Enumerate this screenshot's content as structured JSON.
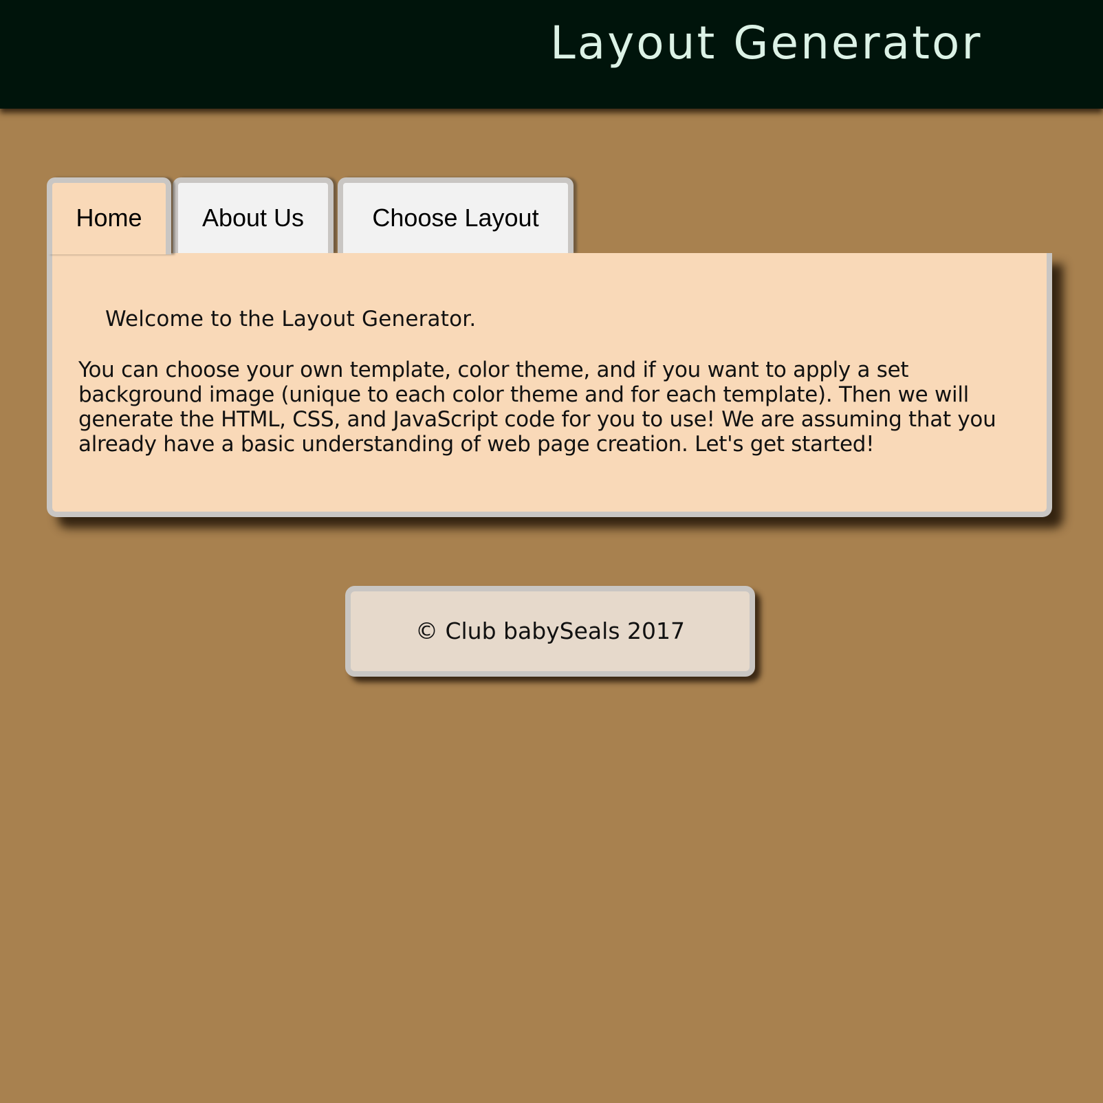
{
  "header": {
    "title": "Layout Generator"
  },
  "tabs": [
    {
      "label": "Home",
      "active": true
    },
    {
      "label": "About Us",
      "active": false
    },
    {
      "label": "Choose Layout",
      "active": false
    }
  ],
  "panel": {
    "welcome": "Welcome to the Layout Generator.",
    "intro": "You can choose your own template, color theme, and if you want to apply a set background image (unique to each color theme and for each template). Then we will generate the HTML, CSS, and JavaScript code for you to use! We are assuming that you already have a basic understanding of web page creation. Let's get started!"
  },
  "footer": {
    "text": "© Club babySeals 2017"
  },
  "colors": {
    "background": "#a8814f",
    "header_bg": "#00140b",
    "header_text": "#dcf2e6",
    "panel_bg": "#f9d9b8",
    "tab_bg": "#f2f2f2",
    "border": "#c9c6c3",
    "footer_bg": "#e6d9cb"
  }
}
